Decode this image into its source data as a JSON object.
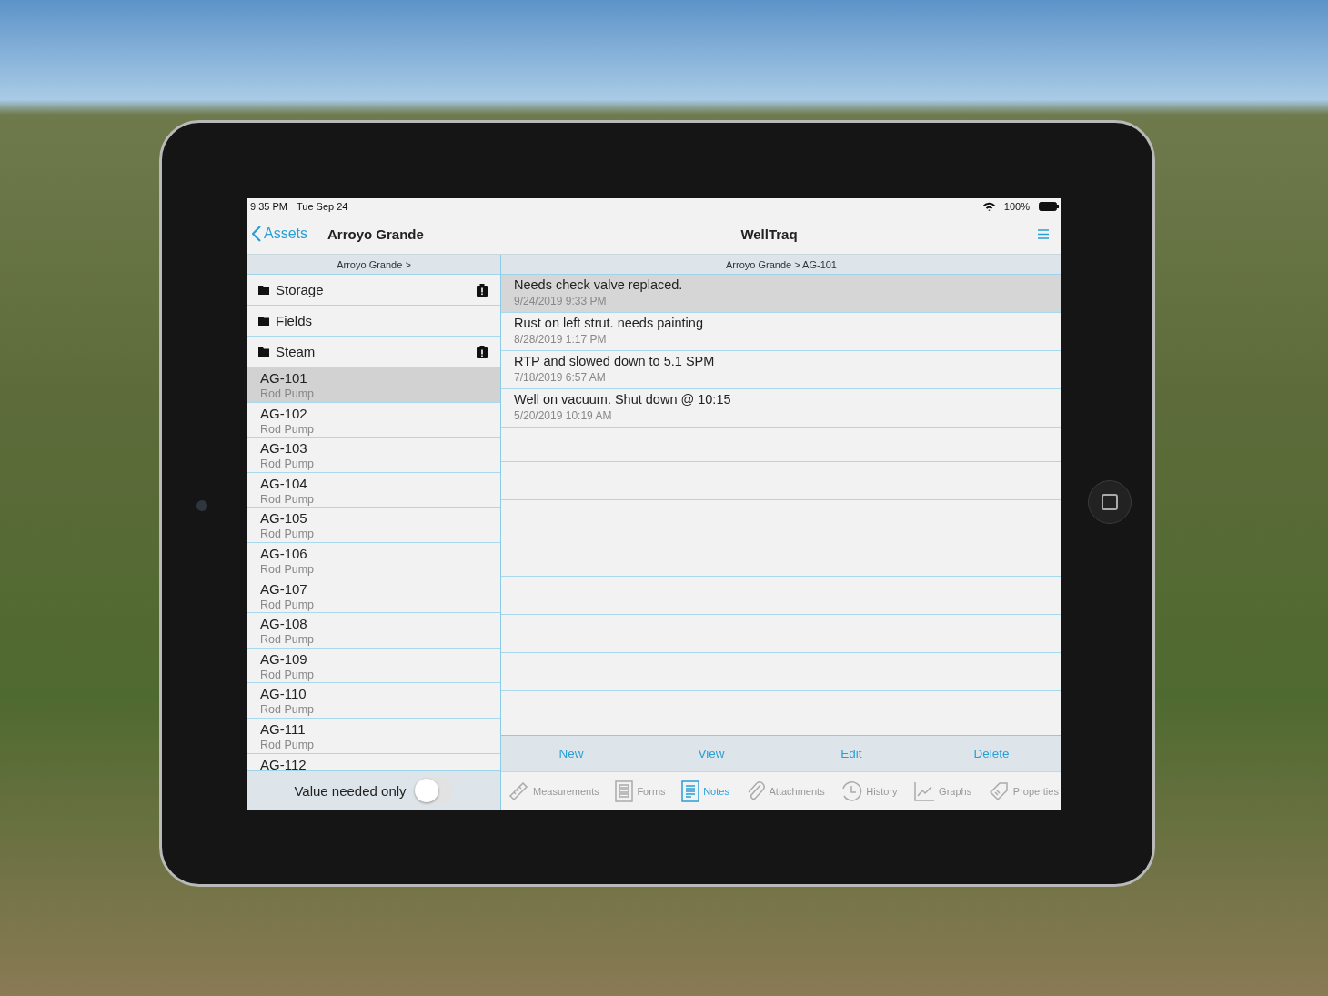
{
  "status_bar": {
    "time": "9:35 PM",
    "date": "Tue Sep 24",
    "battery": "100%"
  },
  "nav_bar": {
    "back": "Assets",
    "title": "Arroyo Grande",
    "app_title": "WellTraq"
  },
  "left_pane": {
    "breadcrumb": "Arroyo Grande >",
    "folders": [
      {
        "name": "Storage",
        "flagged": true
      },
      {
        "name": "Fields",
        "flagged": false
      },
      {
        "name": "Steam",
        "flagged": true
      }
    ],
    "assets": [
      {
        "name": "AG-101",
        "type": "Rod Pump",
        "selected": true
      },
      {
        "name": "AG-102",
        "type": "Rod Pump",
        "selected": false
      },
      {
        "name": "AG-103",
        "type": "Rod Pump",
        "selected": false
      },
      {
        "name": "AG-104",
        "type": "Rod Pump",
        "selected": false
      },
      {
        "name": "AG-105",
        "type": "Rod Pump",
        "selected": false
      },
      {
        "name": "AG-106",
        "type": "Rod Pump",
        "selected": false
      },
      {
        "name": "AG-107",
        "type": "Rod Pump",
        "selected": false
      },
      {
        "name": "AG-108",
        "type": "Rod Pump",
        "selected": false
      },
      {
        "name": "AG-109",
        "type": "Rod Pump",
        "selected": false
      },
      {
        "name": "AG-110",
        "type": "Rod Pump",
        "selected": false
      },
      {
        "name": "AG-111",
        "type": "Rod Pump",
        "selected": false
      },
      {
        "name": "AG-112",
        "selected": false
      }
    ],
    "filter": {
      "label": "Value needed only",
      "on": false
    }
  },
  "right_pane": {
    "breadcrumb": "Arroyo Grande > AG-101",
    "notes": [
      {
        "text": "Needs check valve replaced.",
        "date": "9/24/2019 9:33 PM",
        "selected": true
      },
      {
        "text": "Rust on left strut. needs painting",
        "date": "8/28/2019 1:17 PM",
        "selected": false
      },
      {
        "text": "RTP and slowed down to 5.1 SPM",
        "date": "7/18/2019 6:57 AM",
        "selected": false
      },
      {
        "text": "Well on vacuum. Shut down @ 10:15",
        "date": "5/20/2019 10:19 AM",
        "selected": false
      }
    ],
    "actions": [
      "New",
      "View",
      "Edit",
      "Delete"
    ],
    "tabs": [
      {
        "label": "Measurements",
        "kind": "ruler",
        "selected": false
      },
      {
        "label": "Forms",
        "kind": "form",
        "selected": false
      },
      {
        "label": "Notes",
        "kind": "notes",
        "selected": true
      },
      {
        "label": "Attachments",
        "kind": "clip",
        "selected": false
      },
      {
        "label": "History",
        "kind": "clock",
        "selected": false
      },
      {
        "label": "Graphs",
        "kind": "chart",
        "selected": false
      },
      {
        "label": "Properties",
        "kind": "tag",
        "selected": false
      }
    ]
  }
}
